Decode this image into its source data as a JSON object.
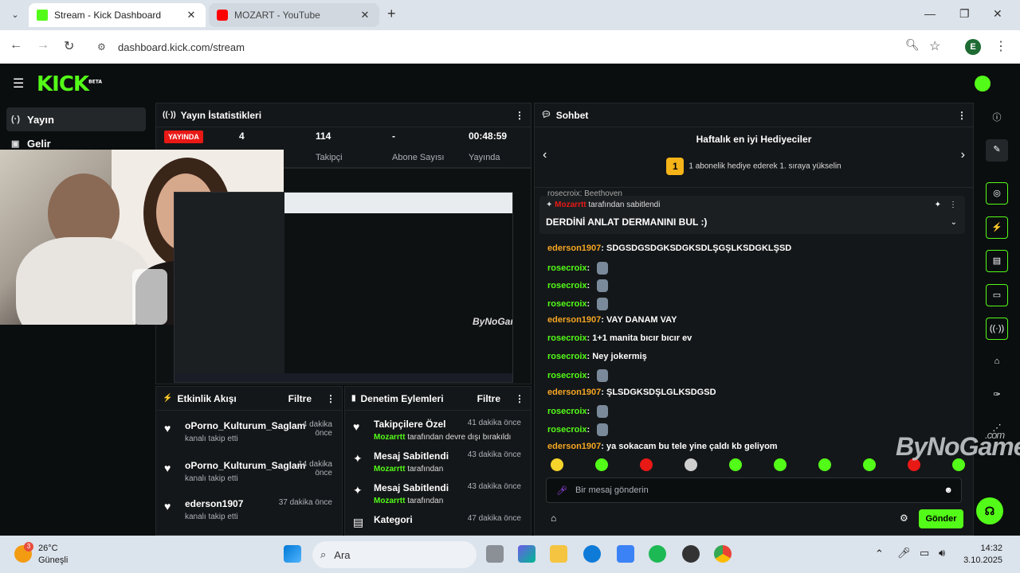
{
  "browser": {
    "tabs": [
      {
        "title": "Stream - Kick Dashboard",
        "active": true,
        "favicon_color": "#53fc18"
      },
      {
        "title": "MOZART - YouTube",
        "active": false,
        "favicon_color": "#ff0000"
      }
    ],
    "url": "dashboard.kick.com/stream",
    "profile_initial": "E"
  },
  "sidebar": {
    "items": [
      {
        "label": "Yayın",
        "icon": "broadcast-icon",
        "active": true
      },
      {
        "label": "Gelir",
        "icon": "revenue-icon",
        "active": false
      }
    ]
  },
  "stats": {
    "title": "Yayın İstatistikleri",
    "live_badge": "YAYINDA",
    "viewers": "4",
    "followers_value": "114",
    "followers_label": "Takipçi",
    "subs_value": "-",
    "subs_label": "Abone Sayısı",
    "uptime_value": "00:48:59",
    "uptime_label": "Yayında"
  },
  "preview": {
    "watermark": "ByNoGame"
  },
  "activity": {
    "title": "Etkinlik Akışı",
    "filter": "Filtre",
    "items": [
      {
        "name": "oPorno_Kulturum_Saglam",
        "desc": "kanalı takip etti",
        "time": "4 dakika önce"
      },
      {
        "name": "oPorno_Kulturum_Saglam",
        "desc": "kanalı takip etti",
        "time": "14 dakika önce"
      },
      {
        "name": "ederson1907",
        "desc": "kanalı takip etti",
        "time": "37 dakika önce"
      }
    ]
  },
  "moderation": {
    "title": "Denetim Eylemleri",
    "filter": "Filtre",
    "items": [
      {
        "title": "Takipçilere Özel",
        "actor": "Mozarrtt",
        "desc": "tarafından devre dışı bırakıldı",
        "time": "41 dakika önce"
      },
      {
        "title": "Mesaj Sabitlendi",
        "actor": "Mozarrtt",
        "desc": "tarafından",
        "time": "43 dakika önce"
      },
      {
        "title": "Mesaj Sabitlendi",
        "actor": "Mozarrtt",
        "desc": "tarafından",
        "time": "43 dakika önce"
      },
      {
        "title": "Kategori",
        "actor": "",
        "desc": "",
        "time": "47 dakika önce"
      }
    ]
  },
  "chat": {
    "title": "Sohbet",
    "gifters_title": "Haftalık en iyi Hediyeciler",
    "gifters_rank": "1",
    "gifters_sub": "1 abonelik hediye ederek 1. sıraya yükselin",
    "pinned_by": "Mozarrtt",
    "pinned_by_suffix": "tarafından sabitlendi",
    "pinned_text": "DERDİNİ ANLAT DERMANINI BUL :)",
    "partial_top": "rosecroix: Beethoven",
    "messages": [
      {
        "user": "ederson1907",
        "text": "SDGSDGSDGKSDGKSDLŞGŞLKSDGKLŞSD",
        "emote": false
      },
      {
        "user": "rosecroix",
        "text": "",
        "emote": true
      },
      {
        "user": "rosecroix",
        "text": "",
        "emote": true
      },
      {
        "user": "rosecroix",
        "text": "",
        "emote": true
      },
      {
        "user": "ederson1907",
        "text": "VAY DANAM VAY",
        "emote": false
      },
      {
        "user": "rosecroix",
        "text": "1+1 manita bıcır bıcır ev",
        "emote": false
      },
      {
        "user": "rosecroix",
        "text": "Ney jokermiş",
        "emote": false
      },
      {
        "user": "rosecroix",
        "text": "",
        "emote": true
      },
      {
        "user": "ederson1907",
        "text": "ŞLSDGKSDŞLGLKSDGSD",
        "emote": false
      },
      {
        "user": "rosecroix",
        "text": "",
        "emote": true
      },
      {
        "user": "rosecroix",
        "text": "",
        "emote": true
      },
      {
        "user": "ederson1907",
        "text": "ya sokacam bu tele yine çaldı kb geliyom",
        "emote": false
      }
    ],
    "input_placeholder": "Bir mesaj gönderin",
    "send_label": "Gönder"
  },
  "overlay_watermark": "ByNoGame",
  "overlay_watermark_suffix": ".com",
  "taskbar": {
    "temp": "26°C",
    "weather": "Güneşli",
    "weather_badge": "3",
    "search": "Ara",
    "time": "14:32",
    "date": "3.10.2025"
  },
  "colors": {
    "kick_green": "#53fc18",
    "live_red": "#e91916",
    "gold": "#f6b419"
  }
}
